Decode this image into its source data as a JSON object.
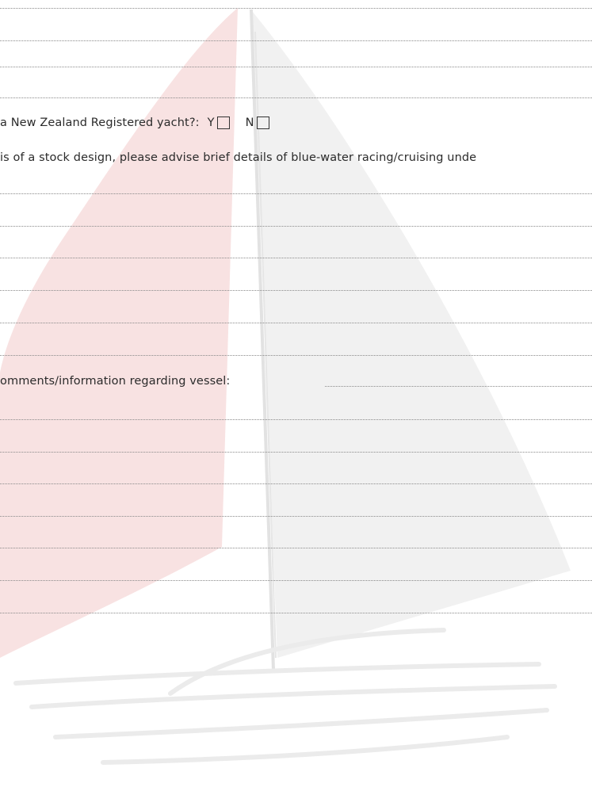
{
  "form": {
    "registered_question": "a New Zealand Registered yacht?:",
    "option_yes": "Y",
    "option_no": "N",
    "stock_design_question": "is of a stock design, please advise brief details of blue-water racing/cruising unde",
    "comments_label": "omments/information regarding vessel:"
  },
  "colors": {
    "sail_red": "#f8e2e2",
    "sail_grey": "#f0f0f0",
    "rule_color": "#8a8a8a",
    "text": "#2b2b2b"
  }
}
